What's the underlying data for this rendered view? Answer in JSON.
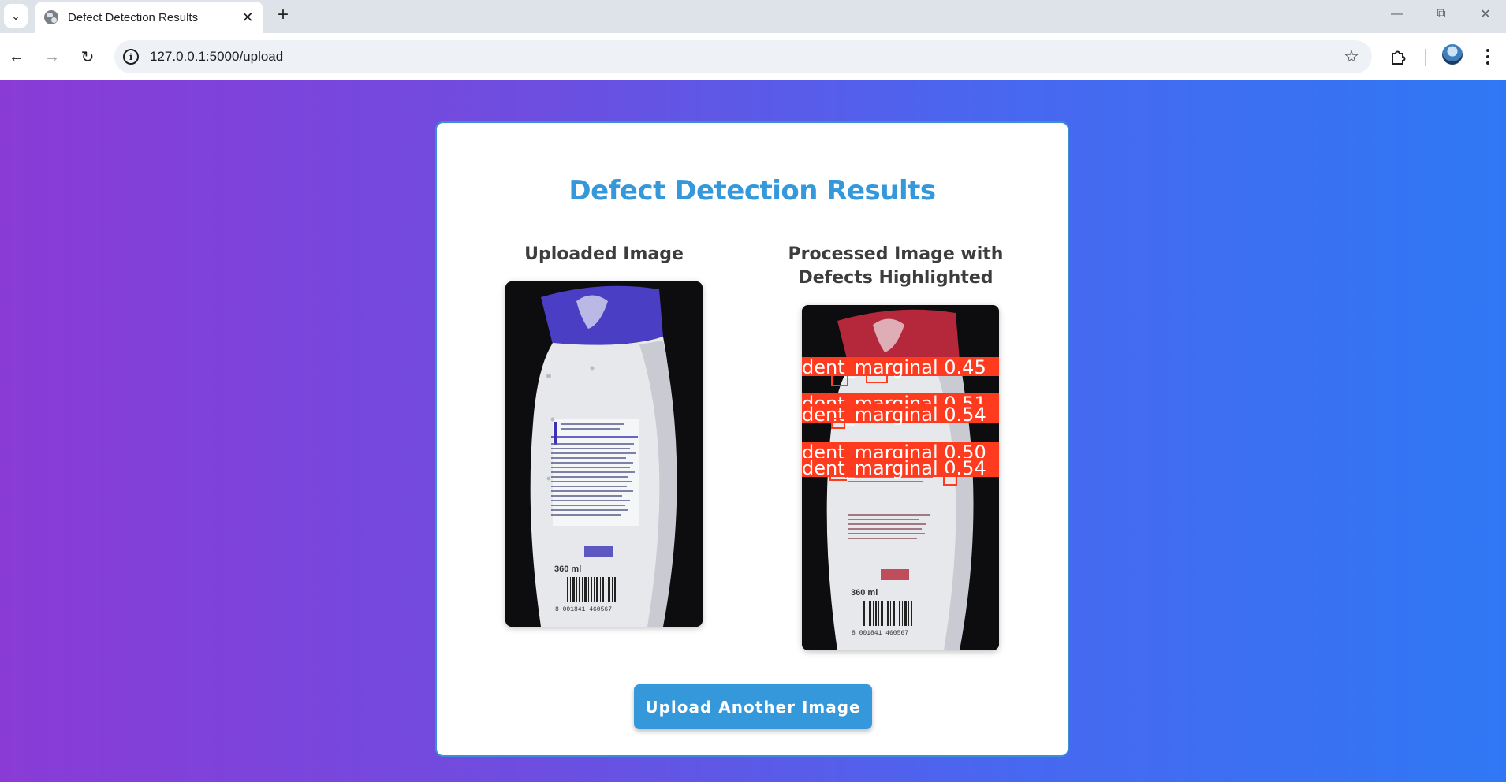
{
  "browser": {
    "tab_title": "Defect Detection Results",
    "url": "127.0.0.1:5000/upload"
  },
  "page": {
    "title": "Defect Detection Results",
    "uploaded_heading": "Uploaded Image",
    "processed_heading": "Processed Image with Defects Highlighted",
    "upload_button": "Upload Another Image"
  },
  "product_label": {
    "volume": "360 ml",
    "barcode": "8 001841 460567"
  },
  "detections": [
    {
      "label": "dent_marginal",
      "confidence": "0.45"
    },
    {
      "label": "dent_marginal",
      "confidence": "0.51"
    },
    {
      "label": "dent_marginal",
      "confidence": "0.54"
    },
    {
      "label": "dent_marginal",
      "confidence": "0.50"
    },
    {
      "label": "dent_marginal",
      "confidence": "0.54"
    }
  ],
  "colors": {
    "accent": "#3498db",
    "detection_box": "#ff3b1f",
    "cap_original": "#4a3fc4",
    "cap_processed": "#b5273a"
  }
}
